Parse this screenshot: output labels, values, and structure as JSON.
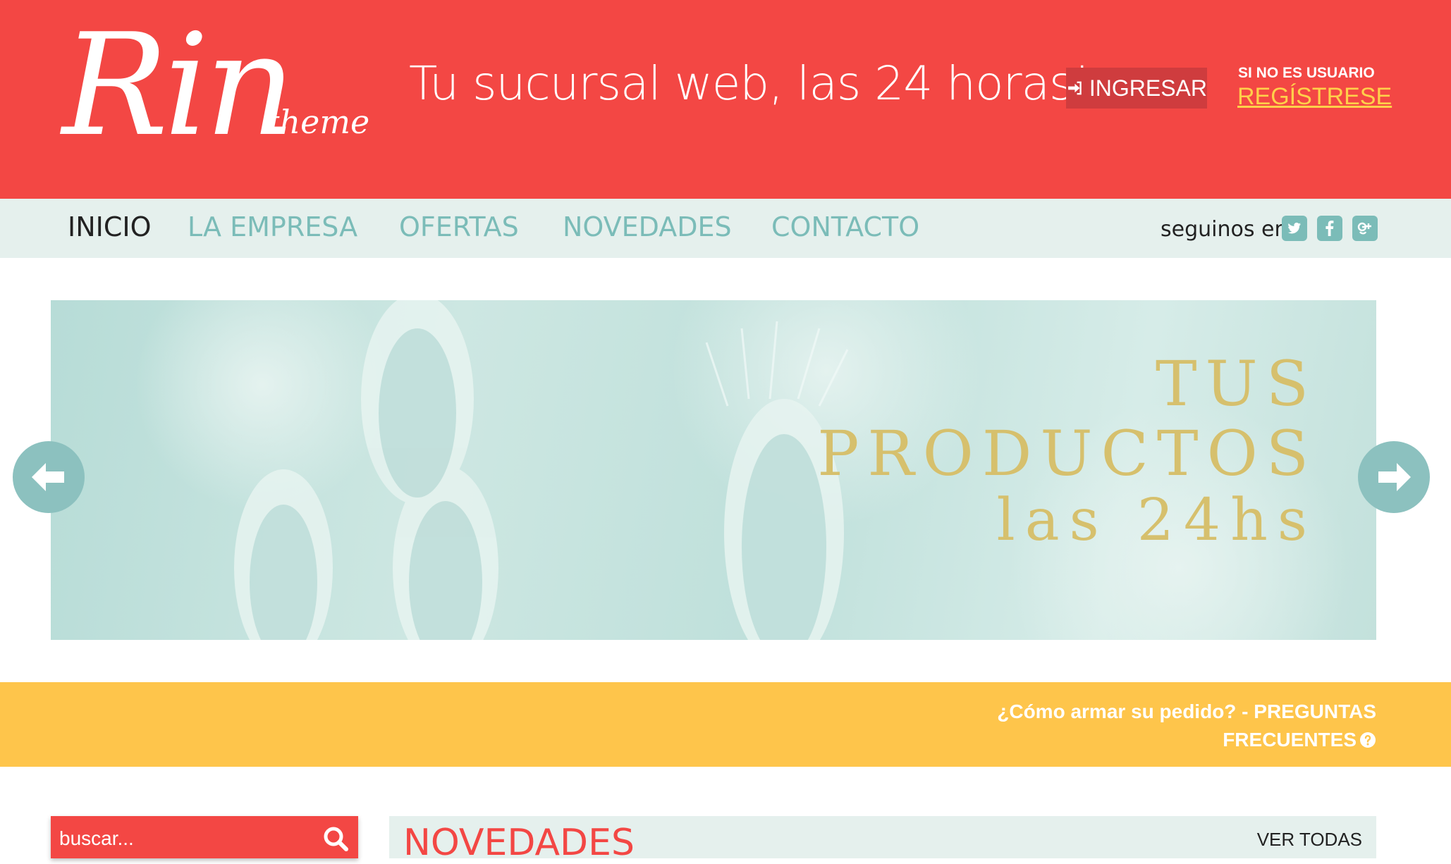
{
  "header": {
    "logo_main": "Rin",
    "logo_sub": "theme",
    "tagline": "Tu sucursal web, las 24 horas!",
    "login_label": "INGRESAR",
    "register_prompt": "SI NO ES USUARIO",
    "register_link": "REGÍSTRESE"
  },
  "nav": {
    "items": [
      {
        "label": "INICIO"
      },
      {
        "label": "LA EMPRESA"
      },
      {
        "label": "OFERTAS"
      },
      {
        "label": "NOVEDADES"
      },
      {
        "label": "CONTACTO"
      }
    ],
    "follow_label": "seguinos en"
  },
  "banner": {
    "line1": "TUS",
    "line2": "PRODUCTOS",
    "line3": "las 24hs"
  },
  "faq": {
    "text_line1": "¿Cómo armar su pedido? - PREGUNTAS",
    "text_line2": "FRECUENTES"
  },
  "search": {
    "placeholder": "buscar..."
  },
  "news": {
    "title": "NOVEDADES",
    "view_all": "VER TODAS"
  },
  "colors": {
    "primary": "#f34744",
    "nav_bg": "#e5f0ed",
    "nav_text": "#7bbcb8",
    "accent_yellow": "#fec54b",
    "banner_text": "#d6c06d"
  }
}
